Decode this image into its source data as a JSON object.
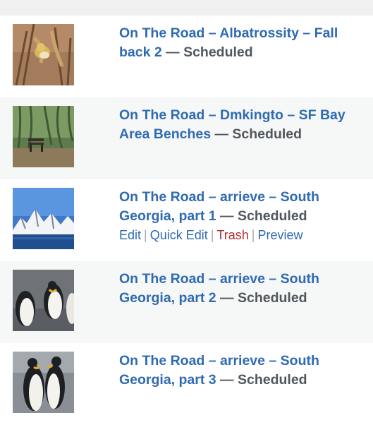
{
  "separator": "—",
  "row_actions": {
    "edit": "Edit",
    "quick_edit": "Quick Edit",
    "trash": "Trash",
    "preview": "Preview",
    "divider": "|"
  },
  "posts": [
    {
      "title": "On The Road – Albatrossity – Fall back 2",
      "status": "Scheduled",
      "thumbnail": "bird-in-grass"
    },
    {
      "title": "On The Road – Dmkingto – SF Bay Area Benches",
      "status": "Scheduled",
      "thumbnail": "bench-under-willow"
    },
    {
      "title": "On The Road – arrieve – South Georgia, part 1",
      "status": "Scheduled",
      "thumbnail": "snowy-mountains"
    },
    {
      "title": "On The Road – arrieve – South Georgia, part 2",
      "status": "Scheduled",
      "thumbnail": "king-penguins"
    },
    {
      "title": "On The Road – arrieve – South Georgia, part 3",
      "status": "Scheduled",
      "thumbnail": "penguin-pair"
    }
  ],
  "colors": {
    "link": "#2f6bb1",
    "status_text": "#50575e",
    "trash": "#b32d2e",
    "row_white": "#ffffff",
    "row_grey": "#f6f7f7"
  }
}
